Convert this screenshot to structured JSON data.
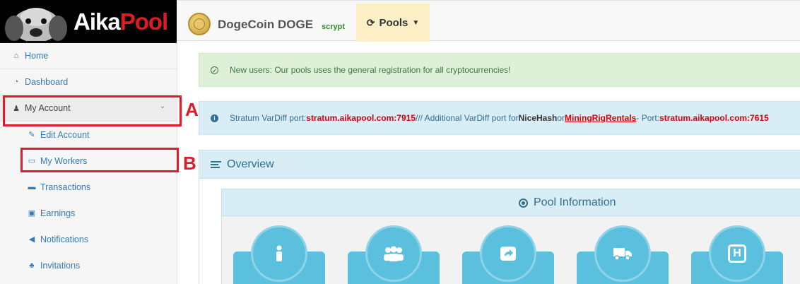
{
  "brand": {
    "logo_part1": "Aika",
    "logo_part2": "Pool"
  },
  "coin": {
    "name": "DogeCoin DOGE",
    "algorithm": "scrypt"
  },
  "toolbar": {
    "pools_label": "Pools"
  },
  "sidebar": {
    "items": [
      {
        "label": "Home",
        "icon": "home-icon"
      },
      {
        "label": "Dashboard",
        "icon": "dashboard-icon"
      },
      {
        "label": "My Account",
        "icon": "user-icon"
      },
      {
        "label": "Edit Account",
        "icon": "edit-icon"
      },
      {
        "label": "My Workers",
        "icon": "monitor-icon"
      },
      {
        "label": "Transactions",
        "icon": "credit-card-icon"
      },
      {
        "label": "Earnings",
        "icon": "money-icon"
      },
      {
        "label": "Notifications",
        "icon": "bullhorn-icon"
      },
      {
        "label": "Invitations",
        "icon": "users-icon"
      }
    ]
  },
  "annotations": {
    "a": "A",
    "b": "B",
    "color": "#e01b2b"
  },
  "alerts": {
    "success": {
      "text": "New users: Our pools uses the general registration for all cryptocurrencies!"
    },
    "info": {
      "t1": "Stratum VarDiff port: ",
      "port1": "stratum.aikapool.com:7915",
      "t2": " /// Additional VarDiff port for ",
      "nicehash": "NiceHash",
      "t3": " or ",
      "mrr": "MiningRigRentals",
      "t4": " - Port: ",
      "port2": "stratum.aikapool.com:7615"
    }
  },
  "overview": {
    "title": "Overview"
  },
  "pool_info": {
    "title": "Pool Information",
    "tiles": [
      {
        "icon": "person-icon"
      },
      {
        "icon": "group-icon"
      },
      {
        "icon": "share-icon"
      },
      {
        "icon": "truck-icon"
      },
      {
        "icon": "hospital-icon",
        "glyph": "H"
      }
    ]
  },
  "colors": {
    "accent_red": "#e01b23",
    "info_blue": "#31708f",
    "tile_blue": "#5bc0de",
    "success_green": "#3c763d",
    "pools_bg": "#fcefc6"
  }
}
